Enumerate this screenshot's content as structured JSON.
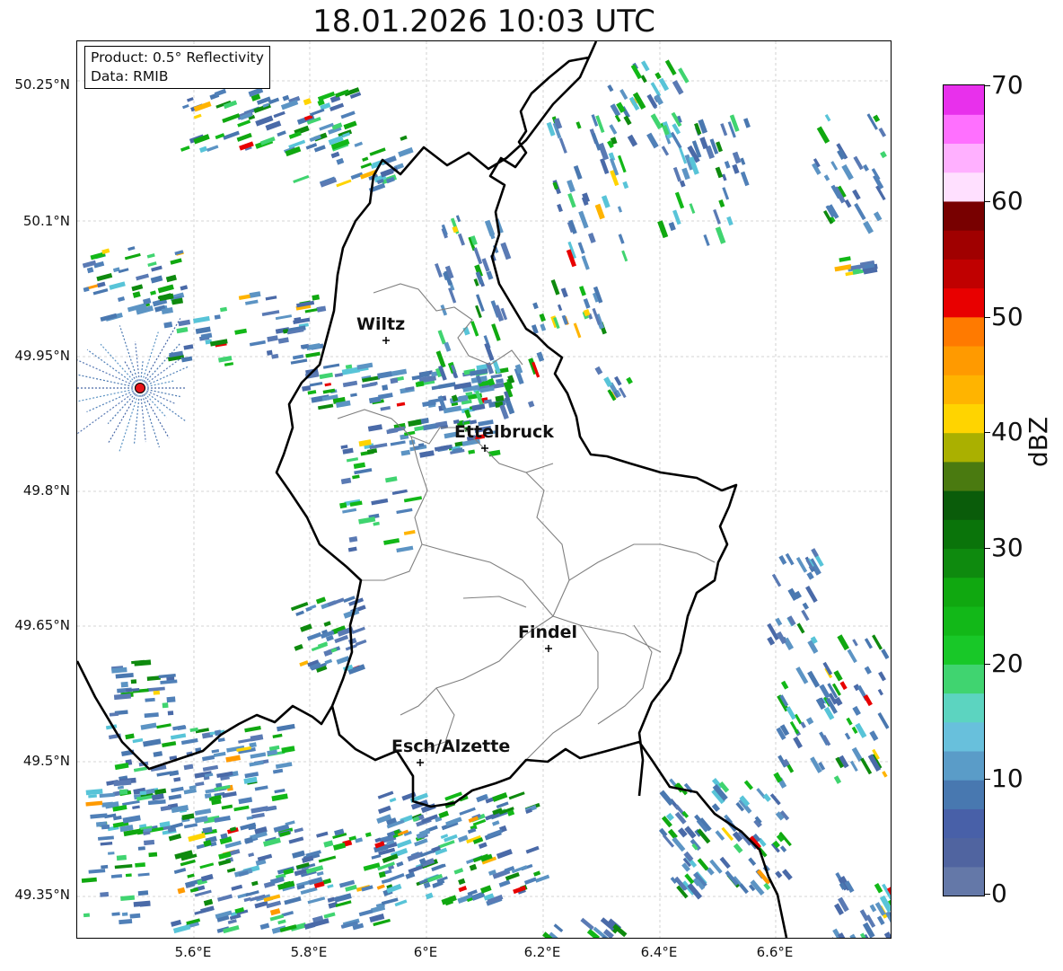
{
  "title": "18.01.2026 10:03 UTC",
  "info_box": {
    "product": "Product: 0.5° Reflectivity",
    "data": "Data: RMIB"
  },
  "latitude_labels": [
    "50.25°N",
    "50.1°N",
    "49.95°N",
    "49.8°N",
    "49.65°N",
    "49.5°N",
    "49.35°N"
  ],
  "longitude_labels": [
    "5.6°E",
    "5.8°E",
    "6°E",
    "6.2°E",
    "6.4°E",
    "6.6°E"
  ],
  "towns": [
    {
      "name": "Wiltz"
    },
    {
      "name": "Ettelbruck"
    },
    {
      "name": "Findel"
    },
    {
      "name": "Esch/Alzette"
    }
  ],
  "radar_site": {
    "color": "#e8141a"
  },
  "colorbar": {
    "unit": "dBZ",
    "tick_labels": [
      "70",
      "60",
      "50",
      "40",
      "30",
      "20",
      "10",
      "0"
    ],
    "colors": [
      "#6478a8",
      "#5064a0",
      "#4860a8",
      "#4878b0",
      "#5a9cc8",
      "#68c0dc",
      "#5cd4c0",
      "#40d470",
      "#18c828",
      "#12b818",
      "#10a810",
      "#0e8a0e",
      "#0a740a",
      "#0a5c0a",
      "#4a7a10",
      "#aab000",
      "#ffd400",
      "#ffb400",
      "#ff9a00",
      "#ff7a00",
      "#e80000",
      "#c00000",
      "#a00000",
      "#780000",
      "#ffe0ff",
      "#ffb0ff",
      "#ff70ff",
      "#e830ec"
    ]
  },
  "colors": {
    "border": "#000000",
    "district": "#808080",
    "grid": "#c8c8c8"
  }
}
